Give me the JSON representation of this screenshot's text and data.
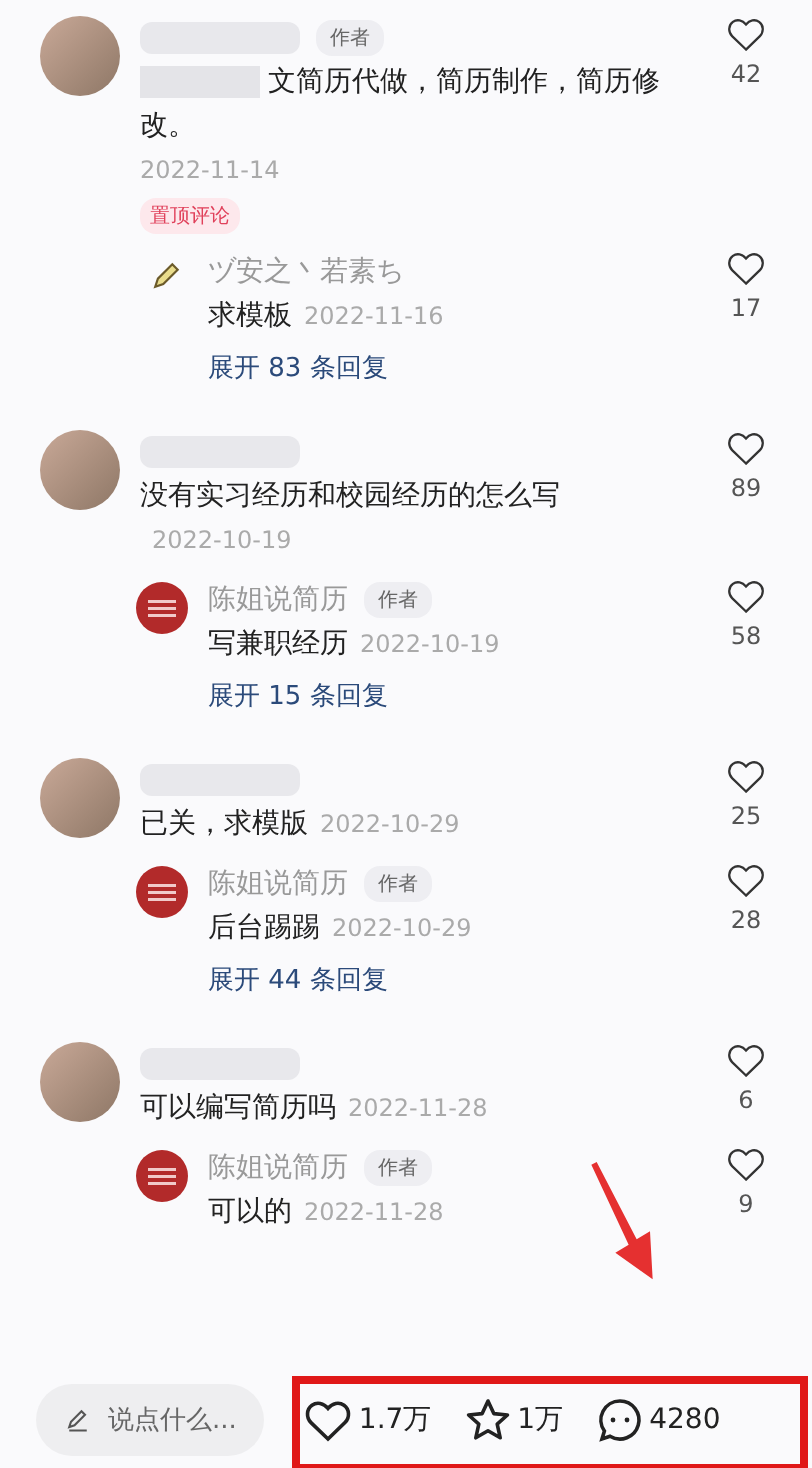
{
  "comments": [
    {
      "author_badge": "作者",
      "blurred_prefix": true,
      "text": "文简历代做，简历制作，简历修改。",
      "date": "2022-11-14",
      "pinned_label": "置顶评论",
      "likes": "42",
      "replies": [
        {
          "kind": "pencil",
          "name": "ヅ安之丶若素ち",
          "text": "求模板",
          "date": "2022-11-16",
          "likes": "17"
        }
      ],
      "expand": "展开 83 条回复"
    },
    {
      "blurred_prefix": false,
      "text": "没有实习经历和校园经历的怎么写",
      "date": "2022-10-19",
      "likes": "89",
      "replies": [
        {
          "kind": "logo",
          "name": "陈姐说简历",
          "author_badge": "作者",
          "text": "写兼职经历",
          "date": "2022-10-19",
          "likes": "58"
        }
      ],
      "expand": "展开 15 条回复"
    },
    {
      "blurred_prefix": false,
      "text": "已关，求模版",
      "date": "2022-10-29",
      "likes": "25",
      "replies": [
        {
          "kind": "logo",
          "name": "陈姐说简历",
          "author_badge": "作者",
          "text": "后台踢踢",
          "date": "2022-10-29",
          "likes": "28"
        }
      ],
      "expand": "展开 44 条回复"
    },
    {
      "blurred_prefix": false,
      "text": "可以编写简历吗",
      "date": "2022-11-28",
      "likes": "6",
      "replies": [
        {
          "kind": "logo",
          "name": "陈姐说简历",
          "author_badge": "作者",
          "text": "可以的",
          "date": "2022-11-28",
          "likes": "9"
        }
      ]
    }
  ],
  "bottom_bar": {
    "placeholder": "说点什么...",
    "likes": "1.7万",
    "favorites": "1万",
    "comments": "4280"
  }
}
